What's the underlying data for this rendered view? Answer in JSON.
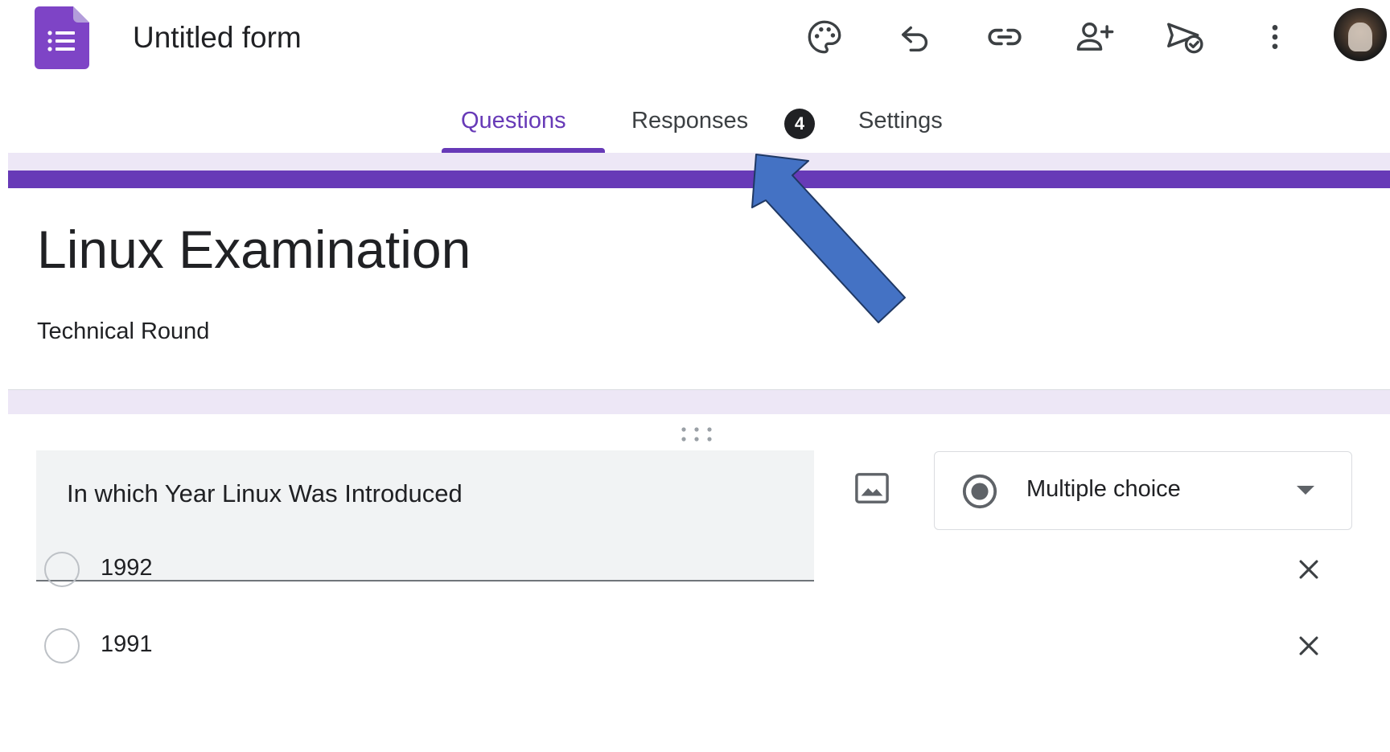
{
  "header": {
    "title": "Untitled form",
    "icons": [
      "palette-icon",
      "undo-icon",
      "link-icon",
      "add-collaborator-icon",
      "publish-icon",
      "more-vert-icon"
    ],
    "accent_color": "#673ab7"
  },
  "tabs": [
    {
      "label": "Questions",
      "active": true
    },
    {
      "label": "Responses",
      "badge": "4"
    },
    {
      "label": "Settings"
    }
  ],
  "form": {
    "title": "Linux Examination",
    "description": "Technical Round"
  },
  "question": {
    "text": "In which Year Linux Was Introduced",
    "type": "Multiple choice",
    "options": [
      "1992",
      "1991"
    ]
  },
  "annotation": {
    "arrow_color": "#4472c4",
    "points_to": "responses-tab"
  }
}
